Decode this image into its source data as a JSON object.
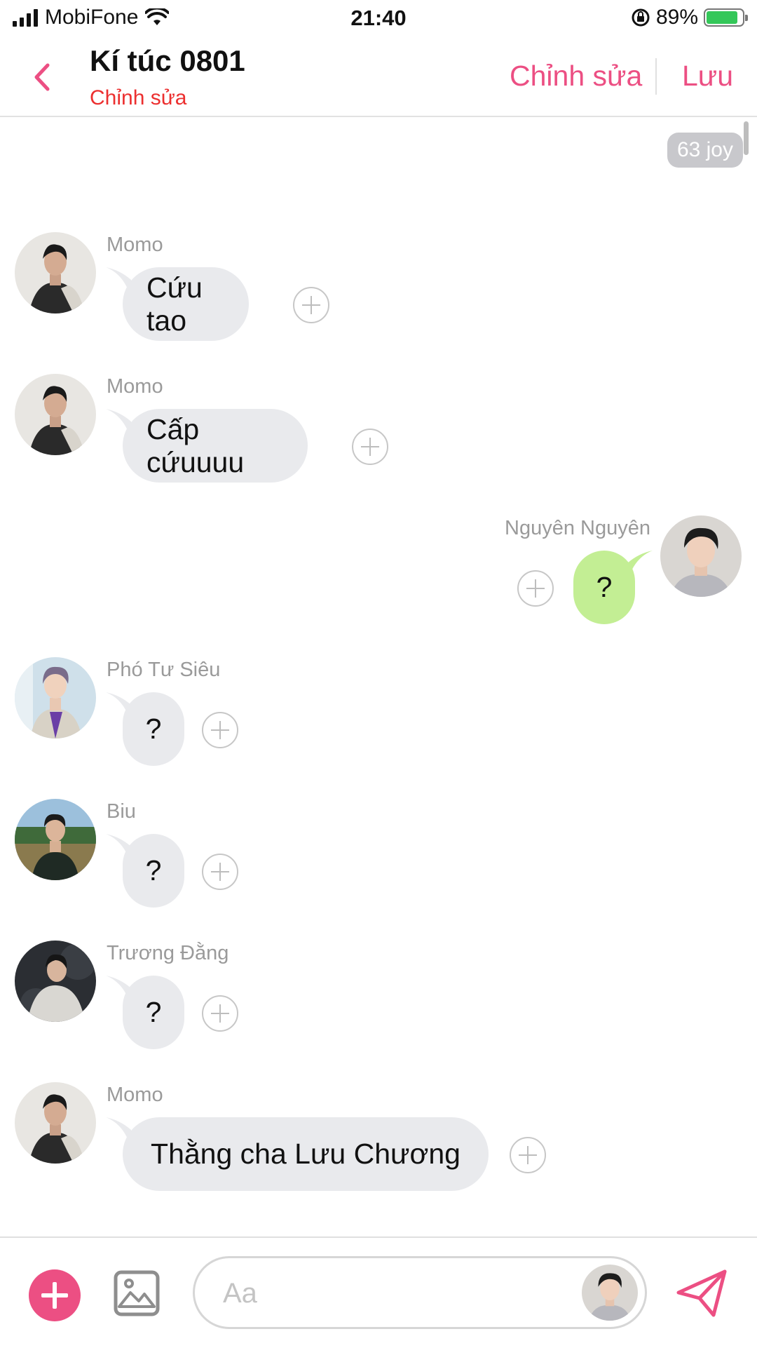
{
  "status_bar": {
    "carrier": "MobiFone",
    "time": "21:40",
    "battery": "89%"
  },
  "header": {
    "title": "Kí túc 0801",
    "subtitle": "Chỉnh sửa",
    "edit_label": "Chỉnh sửa",
    "save_label": "Lưu"
  },
  "chat": {
    "joy_badge": "63 joy",
    "messages": [
      {
        "sender": "Momo",
        "text": "Cứu tao",
        "side": "left"
      },
      {
        "sender": "Momo",
        "text": "Cấp cứuuuu",
        "side": "left"
      },
      {
        "sender": "Nguyên Nguyên",
        "text": "?",
        "side": "right"
      },
      {
        "sender": "Phó Tư Siêu",
        "text": "?",
        "side": "left"
      },
      {
        "sender": "Biu",
        "text": "?",
        "side": "left"
      },
      {
        "sender": "Trương Đằng",
        "text": "?",
        "side": "left"
      },
      {
        "sender": "Momo",
        "text": "Thằng cha Lưu Chương",
        "side": "left"
      }
    ]
  },
  "composer": {
    "placeholder": "Aa"
  },
  "colors": {
    "accent": "#ec4f83",
    "subtitle": "#ec2f2f",
    "bubble": "#e9eaed",
    "own_bubble": "#c3ee94"
  },
  "icons": [
    "back-icon",
    "plus-icon",
    "image-icon",
    "send-icon",
    "wifi-icon",
    "lock-rotation-icon"
  ]
}
